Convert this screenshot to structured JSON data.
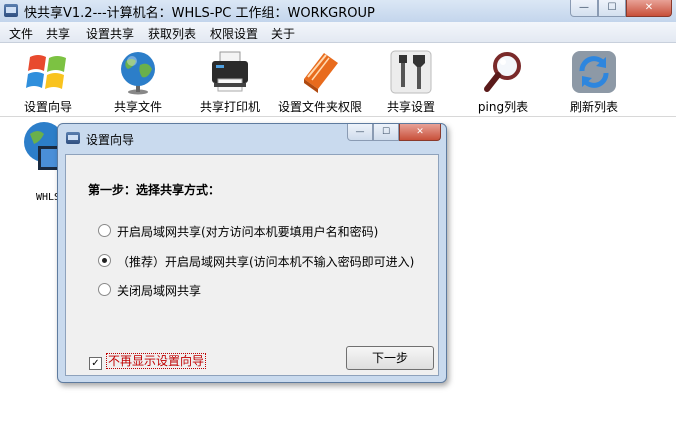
{
  "window": {
    "title": "快共享V1.2---计算机名：WHLS-PC  工作组：WORKGROUP",
    "controls": {
      "minimize": "—",
      "maximize": "☐",
      "close": "✕"
    }
  },
  "menu": [
    "文件",
    "共享",
    "设置共享",
    "获取列表",
    "权限设置",
    "关于"
  ],
  "toolbar": [
    {
      "label": "设置向导",
      "icon": "windows-logo-icon"
    },
    {
      "label": "共享文件",
      "icon": "globe-icon"
    },
    {
      "label": "共享打印机",
      "icon": "printer-icon"
    },
    {
      "label": "设置文件夹权限",
      "icon": "book-icon"
    },
    {
      "label": "共享设置",
      "icon": "tools-icon"
    },
    {
      "label": "ping列表",
      "icon": "magnifier-icon"
    },
    {
      "label": "刷新列表",
      "icon": "refresh-icon"
    }
  ],
  "desktop": {
    "computer_label": "WHLS"
  },
  "dialog": {
    "title": "设置向导",
    "controls": {
      "minimize": "—",
      "maximize": "☐",
      "close": "✕"
    },
    "step_title": "第一步：选择共享方式：",
    "options": [
      {
        "label": "开启局域网共享(对方访问本机要填用户名和密码)",
        "selected": false
      },
      {
        "label": "（推荐）开启局域网共享(访问本机不输入密码即可进入)",
        "selected": true
      },
      {
        "label": "关闭局域网共享",
        "selected": false
      }
    ],
    "checkbox_label": "不再显示设置向导",
    "checkbox_checked": true,
    "checkmark": "✓",
    "next_button": "下一步"
  }
}
